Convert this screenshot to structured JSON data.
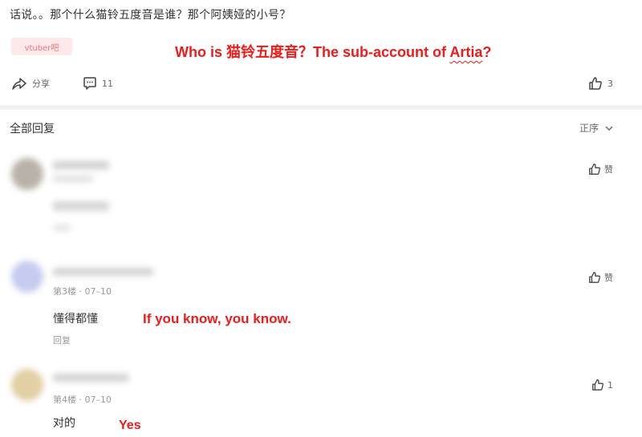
{
  "post": {
    "text": "话说。。那个什么猫铃五度音是谁？那个阿姨娅的小号？",
    "tag": "vtuber吧",
    "annotation_before": "Who is 猫铃五度音？The sub-account of ",
    "annotation_name": "Artia",
    "annotation_after": "?"
  },
  "actions": {
    "share_label": "分享",
    "comment_count": "11",
    "like_count": "3"
  },
  "replies_header": {
    "title": "全部回复",
    "sort_label": "正序"
  },
  "replies": [
    {
      "like_label": "赞"
    },
    {
      "floor": "第3楼 · 07–10",
      "text": "懂得都懂",
      "reply_label": "回复",
      "annotation": "If you know, you know.",
      "like_label": "赞"
    },
    {
      "floor": "第4楼 · 07–10",
      "text": "对的",
      "annotation": "Yes",
      "like_count": "1"
    }
  ],
  "colors": {
    "annotation_red": "#ee1b1b",
    "tag_bg": "#fde8ea",
    "tag_text": "#e8787f"
  }
}
